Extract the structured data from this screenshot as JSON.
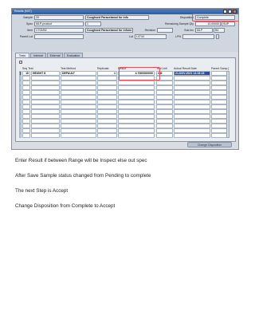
{
  "window": {
    "title": "Results (M07)",
    "header": {
      "sample_label": "Sample",
      "sample_value": "20",
      "sample_desc": "Coughsed Paracetamol for info",
      "spec_label": "Spec",
      "spec_value": "MLP-product",
      "spec_num": "1",
      "item_label": "Item",
      "item_value": "C702/B2",
      "item_desc": "Coughsed Paracetamol for inform",
      "parent_lot_label": "Parent Lot",
      "revision_label": "Revision",
      "lot_label": "Lot",
      "lot_value": "L0744",
      "lpn_label": "LPN",
      "disposition_label": "Disposition",
      "disposition_value": "Complete",
      "remaining_label": "Remaining Sample Qty",
      "remaining_value": "10.00000",
      "remaining_uom": "SUP",
      "subinv_label": "Sub.Inv",
      "subinv_value": "MLP",
      "subinv_code": "B4"
    },
    "tabs": [
      "Tests",
      "Internal",
      "External",
      "Evaluation"
    ],
    "columns": [
      "Seq Test",
      "Test Method",
      "Replicate",
      "Result",
      "Test Unit",
      "Actual Result Date",
      "Parent Samp ["
    ],
    "rows": [
      {
        "seq": "10",
        "test": "HEIGHT 8",
        "method": "DEFAULT",
        "replicate": "1",
        "result": "4.7000000000",
        "unit": "CM",
        "date": "21-NOV-2021 14:18:18"
      }
    ],
    "bottom_button": "Change Disposition"
  },
  "notes": [
    "Enter Result if between Range will be Inspect else out spec",
    "After Save Sample status changed from Pending to complete",
    "The next Step is Accept",
    "Change Disposition from Complete to Accept"
  ]
}
